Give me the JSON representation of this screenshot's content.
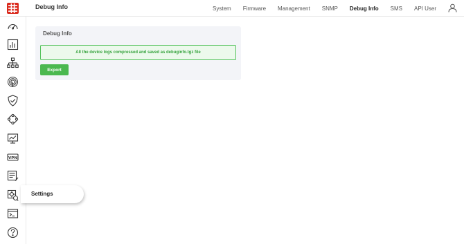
{
  "header": {
    "page_title": "Debug Info",
    "nav": [
      {
        "label": "System"
      },
      {
        "label": "Firmware"
      },
      {
        "label": "Management"
      },
      {
        "label": "SNMP"
      },
      {
        "label": "Debug Info",
        "active": true
      },
      {
        "label": "SMS"
      },
      {
        "label": "API User"
      }
    ]
  },
  "sidebar": {
    "icons": [
      "dashboard-icon",
      "bar-chart-icon",
      "network-topology-icon",
      "fingerprint-icon",
      "shield-check-icon",
      "integration-icon",
      "monitor-icon",
      "vpn-icon",
      "log-icon",
      "settings-icon",
      "terminal-icon",
      "help-icon"
    ],
    "vpn_label": "VPN",
    "tooltip": "Settings"
  },
  "panel": {
    "title": "Debug Info",
    "alert_message": "All the device logs compressed and saved as debuginfo.tgz file",
    "export_label": "Export"
  },
  "colors": {
    "brand_red": "#da291c",
    "success_green": "#4bb84f",
    "alert_bg": "#ecf9ec"
  }
}
